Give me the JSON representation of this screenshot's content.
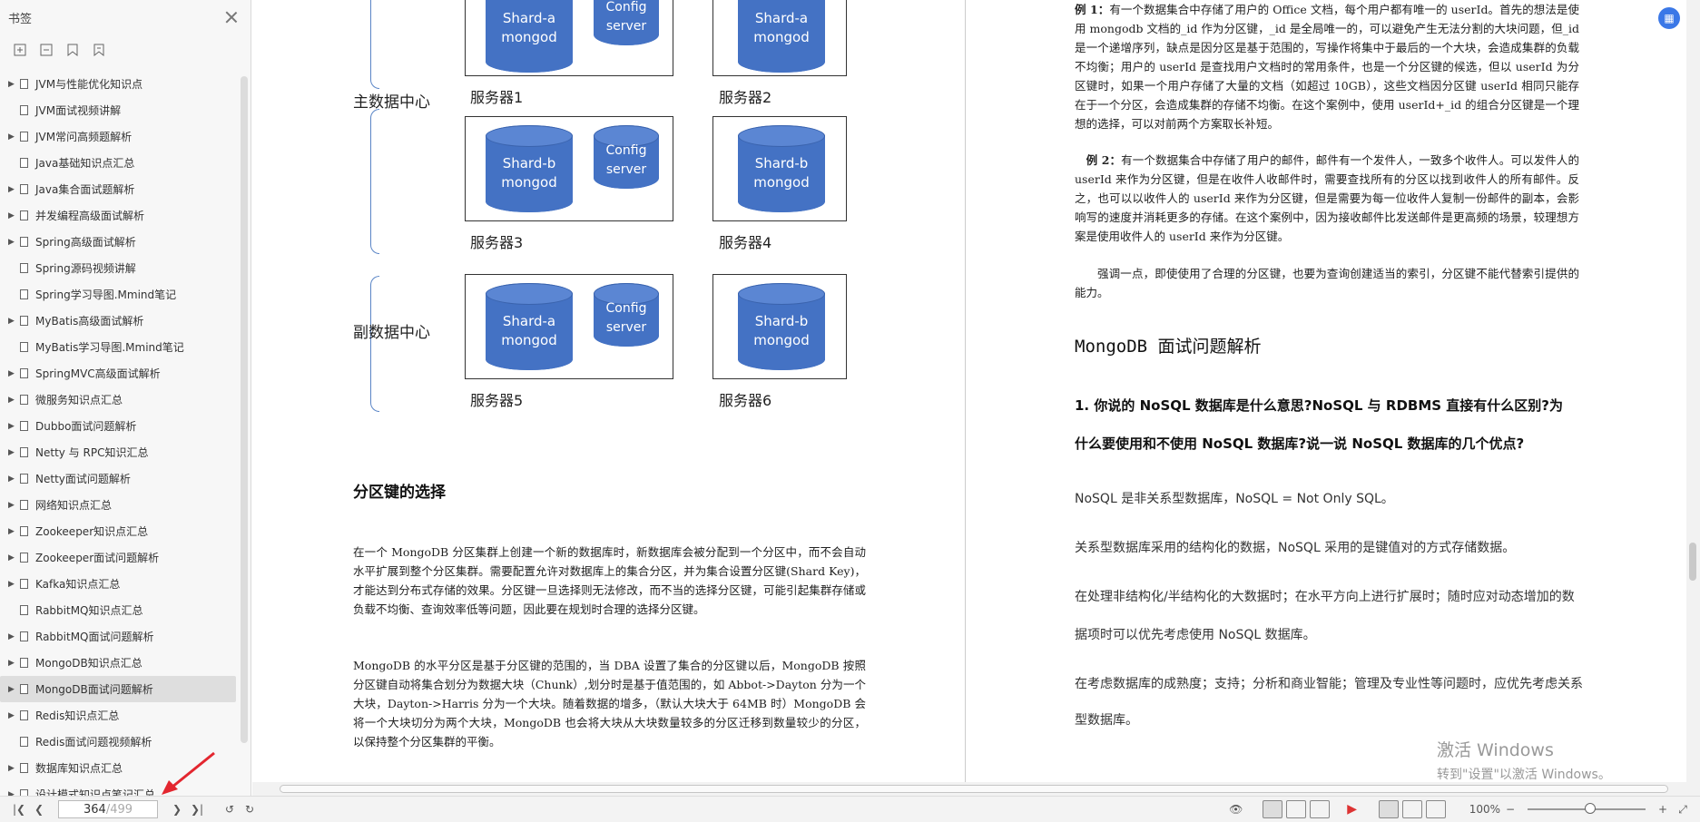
{
  "sidebar": {
    "title": "书签",
    "bookmarks": [
      {
        "label": "JVM与性能优化知识点",
        "expandable": true
      },
      {
        "label": "JVM面试视频讲解",
        "expandable": false
      },
      {
        "label": "JVM常问高频题解析",
        "expandable": true
      },
      {
        "label": "Java基础知识点汇总",
        "expandable": false
      },
      {
        "label": "Java集合面试题解析",
        "expandable": true
      },
      {
        "label": "并发编程高级面试解析",
        "expandable": true
      },
      {
        "label": "Spring高级面试解析",
        "expandable": true
      },
      {
        "label": "Spring源码视频讲解",
        "expandable": false
      },
      {
        "label": "Spring学习导图.Mmind笔记",
        "expandable": false
      },
      {
        "label": "MyBatis高级面试解析",
        "expandable": true
      },
      {
        "label": "MyBatis学习导图.Mmind笔记",
        "expandable": false
      },
      {
        "label": "SpringMVC高级面试解析",
        "expandable": true
      },
      {
        "label": "微服务知识点汇总",
        "expandable": true
      },
      {
        "label": "Dubbo面试问题解析",
        "expandable": true
      },
      {
        "label": " Netty 与 RPC知识汇总",
        "expandable": true
      },
      {
        "label": "Netty面试问题解析",
        "expandable": true
      },
      {
        "label": "网络知识点汇总",
        "expandable": true
      },
      {
        "label": "Zookeeper知识点汇总",
        "expandable": true
      },
      {
        "label": "Zookeeper面试问题解析",
        "expandable": true
      },
      {
        "label": "Kafka知识点汇总",
        "expandable": true
      },
      {
        "label": "RabbitMQ知识点汇总",
        "expandable": false
      },
      {
        "label": "RabbitMQ面试问题解析",
        "expandable": true
      },
      {
        "label": "MongoDB知识点汇总",
        "expandable": true
      },
      {
        "label": "MongoDB面试问题解析",
        "expandable": true,
        "selected": true
      },
      {
        "label": "Redis知识点汇总",
        "expandable": true
      },
      {
        "label": "Redis面试问题视频解析",
        "expandable": false
      },
      {
        "label": "数据库知识点汇总",
        "expandable": true
      },
      {
        "label": "设计模式知识点笔记汇总",
        "expandable": true
      }
    ]
  },
  "diagram": {
    "main_dc": "主数据中心",
    "backup_dc": "副数据中心",
    "servers": [
      "服务器1",
      "服务器2",
      "服务器3",
      "服务器4",
      "服务器5",
      "服务器6"
    ],
    "shard_a": [
      "Shard-a",
      "mongod"
    ],
    "shard_b": [
      "Shard-b",
      "mongod"
    ],
    "config": [
      "Config",
      "server"
    ]
  },
  "left_page": {
    "heading": "分区键的选择",
    "p1": "在一个 MongoDB 分区集群上创建一个新的数据库时，新数据库会被分配到一个分区中，而不会自动水平扩展到整个分区集群。需要配置允许对数据库上的集合分区，并为集合设置分区键(Shard Key)，才能达到分布式存储的效果。分区键一旦选择则无法修改，而不当的选择分区键，可能引起集群存储或负载不均衡、查询效率低等问题，因此要在规划时合理的选择分区键。",
    "p2": "MongoDB 的水平分区是基于分区键的范围的，当 DBA 设置了集合的分区键以后，MongoDB 按照分区键自动将集合划分为数据大块（Chunk）,划分时是基于值范围的，如 Abbot->Dayton 分为一个大块，Dayton->Harris 分为一个大块。随着数据的增多，（默认大块大于 64MB 时）MongoDB 会将一个大块切分为两个大块，MongoDB 也会将大块从大块数量较多的分区迁移到数量较少的分区，以保持整个分区集群的平衡。"
  },
  "right_page": {
    "ex1_label": "例 1：",
    "ex1": "有一个数据集合中存储了用户的 Office 文档，每个用户都有唯一的 userId。首先的想法是使用 mongodb 文档的_id 作为分区键，_id 是全局唯一的，可以避免产生无法分割的大块问题，但_id 是一个递增序列，缺点是因分区是基于范围的，写操作将集中于最后的一个大块，会造成集群的负载不均衡；用户的 userId 是查找用户文档时的常用条件，也是一个分区键的候选，但以 userId 为分区键时，如果一个用户存储了大量的文档（如超过 10GB），这些文档因分区键 userId 相同只能存在于一个分区，会造成集群的存储不均衡。在这个案例中，使用 userId+_id 的组合分区键是一个理想的选择，可以对前两个方案取长补短。",
    "ex2_label": "例 2：",
    "ex2": "有一个数据集合中存储了用户的邮件，邮件有一个发件人，一致多个收件人。可以发件人的 userId 来作为分区键，但是在收件人收邮件时，需要查找所有的分区以找到收件人的所有邮件。反之，也可以以收件人的 userId 来作为分区键，但是需要为每一位收件人复制一份邮件的副本，会影响写的速度并消耗更多的存储。在这个案例中，因为接收邮件比发送邮件是更高频的场景，较理想方案是使用收件人的 userId 来作为分区键。",
    "emphasis": "强调一点，即使使用了合理的分区键，也要为查询创建适当的索引，分区键不能代替索引提供的能力。",
    "section_title": "MongoDB 面试问题解析",
    "q1_line1": "1. 你说的 NoSQL 数据库是什么意思?NoSQL 与 RDBMS 直接有什么区别?为",
    "q1_line2": "什么要使用和不使用 NoSQL 数据库?说一说 NoSQL 数据库的几个优点?",
    "a1": "NoSQL 是非关系型数据库，NoSQL = Not Only SQL。",
    "a2": "关系型数据库采用的结构化的数据，NoSQL 采用的是键值对的方式存储数据。",
    "a3_line1": "在处理非结构化/半结构化的大数据时；在水平方向上进行扩展时；随时应对动态增加的数",
    "a3_line2": "据项时可以优先考虑使用 NoSQL 数据库。",
    "a4_line1": "在考虑数据库的成熟度；支持；分析和商业智能；管理及专业性等问题时，应优先考虑关系",
    "a4_line2": "型数据库。"
  },
  "watermark": {
    "line1": "激活 Windows",
    "line2": "转到\"设置\"以激活 Windows。"
  },
  "statusbar": {
    "current_page": "364",
    "total_pages": "/499",
    "zoom": "100%"
  }
}
